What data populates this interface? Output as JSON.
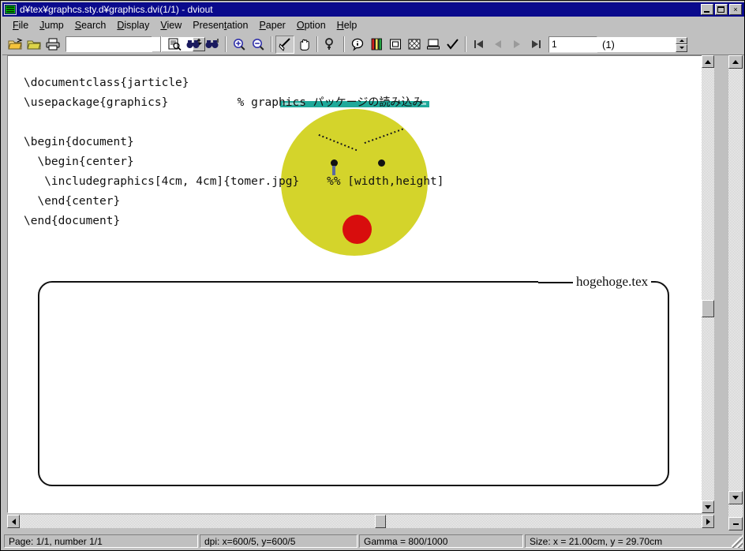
{
  "window": {
    "title": "d¥tex¥graphcs.sty.d¥graphics.dvi(1/1) - dviout",
    "icon": "app-icon",
    "minimize_label": "Minimize",
    "maximize_label": "Maximize",
    "close_label": "×"
  },
  "menubar": {
    "items": [
      {
        "label": "File",
        "accel": "F"
      },
      {
        "label": "Jump",
        "accel": "J"
      },
      {
        "label": "Search",
        "accel": "S"
      },
      {
        "label": "Display",
        "accel": "D"
      },
      {
        "label": "View",
        "accel": "V"
      },
      {
        "label": "Presentation",
        "accel": "t"
      },
      {
        "label": "Paper",
        "accel": "P"
      },
      {
        "label": "Option",
        "accel": "O"
      },
      {
        "label": "Help",
        "accel": "H"
      }
    ]
  },
  "toolbar": {
    "buttons": [
      {
        "name": "open-folder-icon",
        "tip": "Open"
      },
      {
        "name": "open-recent-icon",
        "tip": "Re-open"
      },
      {
        "name": "print-icon",
        "tip": "Print"
      },
      {
        "name": "preview-icon",
        "tip": "Preview"
      },
      {
        "name": "search-forward-icon",
        "tip": "Search forward"
      },
      {
        "name": "search-backward-icon",
        "tip": "Search backward"
      },
      {
        "name": "zoom-in-icon",
        "tip": "Zoom in"
      },
      {
        "name": "zoom-out-icon",
        "tip": "Zoom out"
      },
      {
        "name": "pointer-icon",
        "tip": "Pointer"
      },
      {
        "name": "hand-icon",
        "tip": "Hand / pan"
      },
      {
        "name": "magnifier-tool-icon",
        "tip": "Magnify"
      },
      {
        "name": "info-icon",
        "tip": "Information"
      },
      {
        "name": "color-icon",
        "tip": "Color"
      },
      {
        "name": "frame-icon",
        "tip": "Frame"
      },
      {
        "name": "pattern-icon",
        "tip": "Pattern"
      },
      {
        "name": "display-icon",
        "tip": "Display"
      },
      {
        "name": "check-icon",
        "tip": "Check"
      },
      {
        "name": "first-page-icon",
        "tip": "First page"
      },
      {
        "name": "previous-page-icon",
        "tip": "Previous page"
      },
      {
        "name": "next-page-icon",
        "tip": "Next page"
      },
      {
        "name": "last-page-icon",
        "tip": "Last page"
      }
    ],
    "file_combo": {
      "value": "",
      "placeholder": ""
    },
    "page_field": {
      "value": "1"
    },
    "page_total": "(1)"
  },
  "document": {
    "image": {
      "name": "tomer-jpg-face",
      "titlebar_color": "#1fa99a",
      "face_color": "#d4d42b",
      "nose_color": "#d80d0d",
      "eye_color": "#121212"
    },
    "codebox": {
      "file_label": "hogehoge.tex",
      "lines": [
        "\\documentclass{jarticle}",
        "\\usepackage{graphics}          % graphics パッケージの読み込み",
        "",
        "\\begin{document}",
        "  \\begin{center}",
        "   \\includegraphics[4cm, 4cm]{tomer.jpg}    %% [width,height]",
        "  \\end{center}",
        "\\end{document}"
      ]
    }
  },
  "statusbar": {
    "page": "Page: 1/1, number 1/1",
    "dpi": "dpi: x=600/5, y=600/5",
    "gamma": "Gamma = 800/1000",
    "size": "Size: x = 21.00cm, y = 29.70cm"
  }
}
